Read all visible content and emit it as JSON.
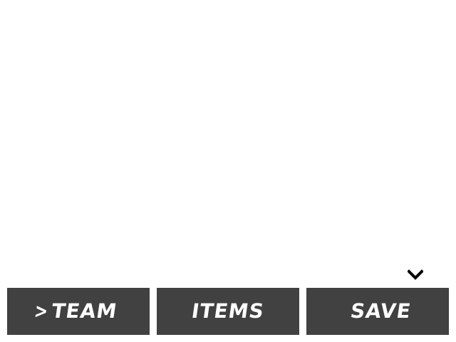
{
  "menu": {
    "selected_cursor": ">",
    "items": [
      {
        "label": "TEAM",
        "selected": true
      },
      {
        "label": "ITEMS",
        "selected": false
      },
      {
        "label": "SAVE",
        "selected": false
      }
    ]
  },
  "indicator": {
    "icon": "chevron-down-icon",
    "color": "#000000"
  },
  "colors": {
    "button_background": "#414141",
    "button_text": "#ffffff",
    "screen_background": "#ffffff"
  }
}
